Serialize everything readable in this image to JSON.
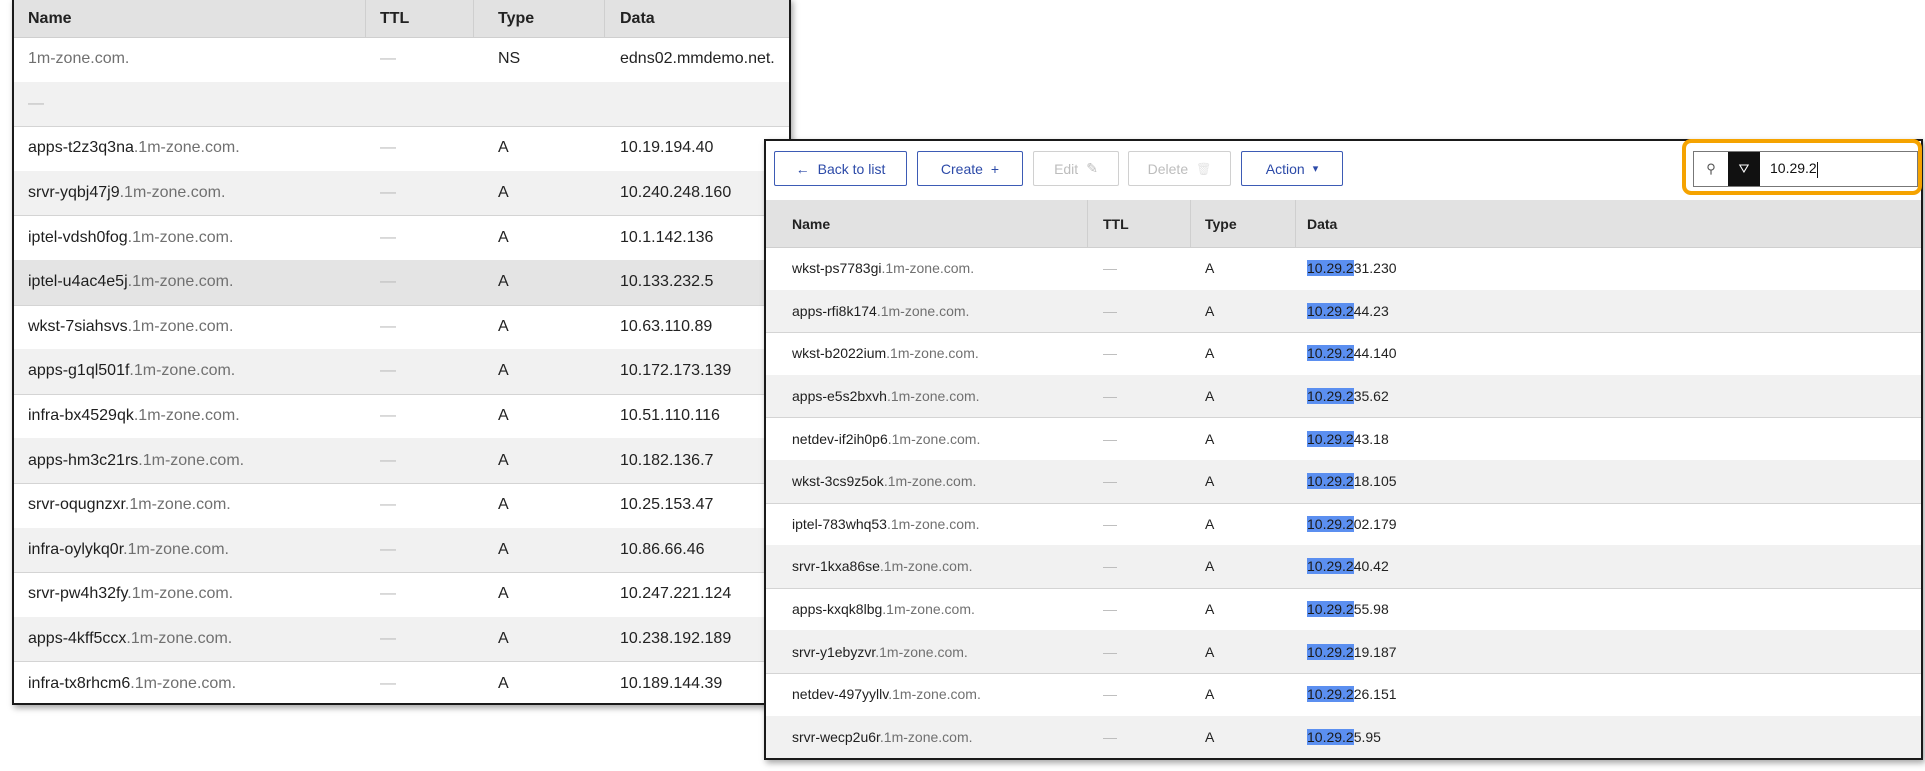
{
  "left_table": {
    "columns": [
      "Name",
      "TTL",
      "Type",
      "Data"
    ],
    "rows": [
      {
        "host": "",
        "zone": "1m-zone.com.",
        "ttl": "—",
        "type": "NS",
        "data": "edns02.mmdemo.net."
      },
      {
        "host": "",
        "zone": "—",
        "ttl": "",
        "type": "",
        "data": ""
      },
      {
        "host": "apps-t2z3q3na",
        "zone": ".1m-zone.com.",
        "ttl": "—",
        "type": "A",
        "data": "10.19.194.40"
      },
      {
        "host": "srvr-yqbj47j9",
        "zone": ".1m-zone.com.",
        "ttl": "—",
        "type": "A",
        "data": "10.240.248.160"
      },
      {
        "host": "iptel-vdsh0fog",
        "zone": ".1m-zone.com.",
        "ttl": "—",
        "type": "A",
        "data": "10.1.142.136"
      },
      {
        "host": "iptel-u4ac4e5j",
        "zone": ".1m-zone.com.",
        "ttl": "—",
        "type": "A",
        "data": "10.133.232.5"
      },
      {
        "host": "wkst-7siahsvs",
        "zone": ".1m-zone.com.",
        "ttl": "—",
        "type": "A",
        "data": "10.63.110.89"
      },
      {
        "host": "apps-g1ql501f",
        "zone": ".1m-zone.com.",
        "ttl": "—",
        "type": "A",
        "data": "10.172.173.139"
      },
      {
        "host": "infra-bx4529qk",
        "zone": ".1m-zone.com.",
        "ttl": "—",
        "type": "A",
        "data": "10.51.110.116"
      },
      {
        "host": "apps-hm3c21rs",
        "zone": ".1m-zone.com.",
        "ttl": "—",
        "type": "A",
        "data": "10.182.136.7"
      },
      {
        "host": "srvr-oqugnzxr",
        "zone": ".1m-zone.com.",
        "ttl": "—",
        "type": "A",
        "data": "10.25.153.47"
      },
      {
        "host": "infra-oylykq0r",
        "zone": ".1m-zone.com.",
        "ttl": "—",
        "type": "A",
        "data": "10.86.66.46"
      },
      {
        "host": "srvr-pw4h32fy",
        "zone": ".1m-zone.com.",
        "ttl": "—",
        "type": "A",
        "data": "10.247.221.124"
      },
      {
        "host": "apps-4kff5ccx",
        "zone": ".1m-zone.com.",
        "ttl": "—",
        "type": "A",
        "data": "10.238.192.189"
      },
      {
        "host": "infra-tx8rhcm6",
        "zone": ".1m-zone.com.",
        "ttl": "—",
        "type": "A",
        "data": "10.189.144.39"
      }
    ]
  },
  "toolbar": {
    "back_label": "Back to list",
    "back_icon": "←",
    "create_label": "Create",
    "create_icon": "+",
    "edit_label": "Edit",
    "edit_icon": "✎",
    "delete_label": "Delete",
    "delete_icon": "🗑",
    "action_label": "Action",
    "action_icon": "▾"
  },
  "search": {
    "value": "10.29.2",
    "search_icon": "⚲",
    "filter_icon": "⛛"
  },
  "highlight_color": "#5b8ff0",
  "focus_color": "#f5a300",
  "right_table": {
    "columns": [
      "Name",
      "TTL",
      "Type",
      "Data"
    ],
    "rows": [
      {
        "host": "wkst-ps7783gi",
        "zone": ".1m-zone.com.",
        "ttl": "—",
        "type": "A",
        "match": "10.29.2",
        "rest": "31.230"
      },
      {
        "host": "apps-rfi8k174",
        "zone": ".1m-zone.com.",
        "ttl": "—",
        "type": "A",
        "match": "10.29.2",
        "rest": "44.23"
      },
      {
        "host": "wkst-b2022ium",
        "zone": ".1m-zone.com.",
        "ttl": "—",
        "type": "A",
        "match": "10.29.2",
        "rest": "44.140"
      },
      {
        "host": "apps-e5s2bxvh",
        "zone": ".1m-zone.com.",
        "ttl": "—",
        "type": "A",
        "match": "10.29.2",
        "rest": "35.62"
      },
      {
        "host": "netdev-if2ih0p6",
        "zone": ".1m-zone.com.",
        "ttl": "—",
        "type": "A",
        "match": "10.29.2",
        "rest": "43.18"
      },
      {
        "host": "wkst-3cs9z5ok",
        "zone": ".1m-zone.com.",
        "ttl": "—",
        "type": "A",
        "match": "10.29.2",
        "rest": "18.105"
      },
      {
        "host": "iptel-783whq53",
        "zone": ".1m-zone.com.",
        "ttl": "—",
        "type": "A",
        "match": "10.29.2",
        "rest": "02.179"
      },
      {
        "host": "srvr-1kxa86se",
        "zone": ".1m-zone.com.",
        "ttl": "—",
        "type": "A",
        "match": "10.29.2",
        "rest": "40.42"
      },
      {
        "host": "apps-kxqk8lbg",
        "zone": ".1m-zone.com.",
        "ttl": "—",
        "type": "A",
        "match": "10.29.2",
        "rest": "55.98"
      },
      {
        "host": "srvr-y1ebyzvr",
        "zone": ".1m-zone.com.",
        "ttl": "—",
        "type": "A",
        "match": "10.29.2",
        "rest": "19.187"
      },
      {
        "host": "netdev-497yyllv",
        "zone": ".1m-zone.com.",
        "ttl": "—",
        "type": "A",
        "match": "10.29.2",
        "rest": "26.151"
      },
      {
        "host": "srvr-wecp2u6r",
        "zone": ".1m-zone.com.",
        "ttl": "—",
        "type": "A",
        "match": "10.29.2",
        "rest": "5.95"
      }
    ]
  }
}
